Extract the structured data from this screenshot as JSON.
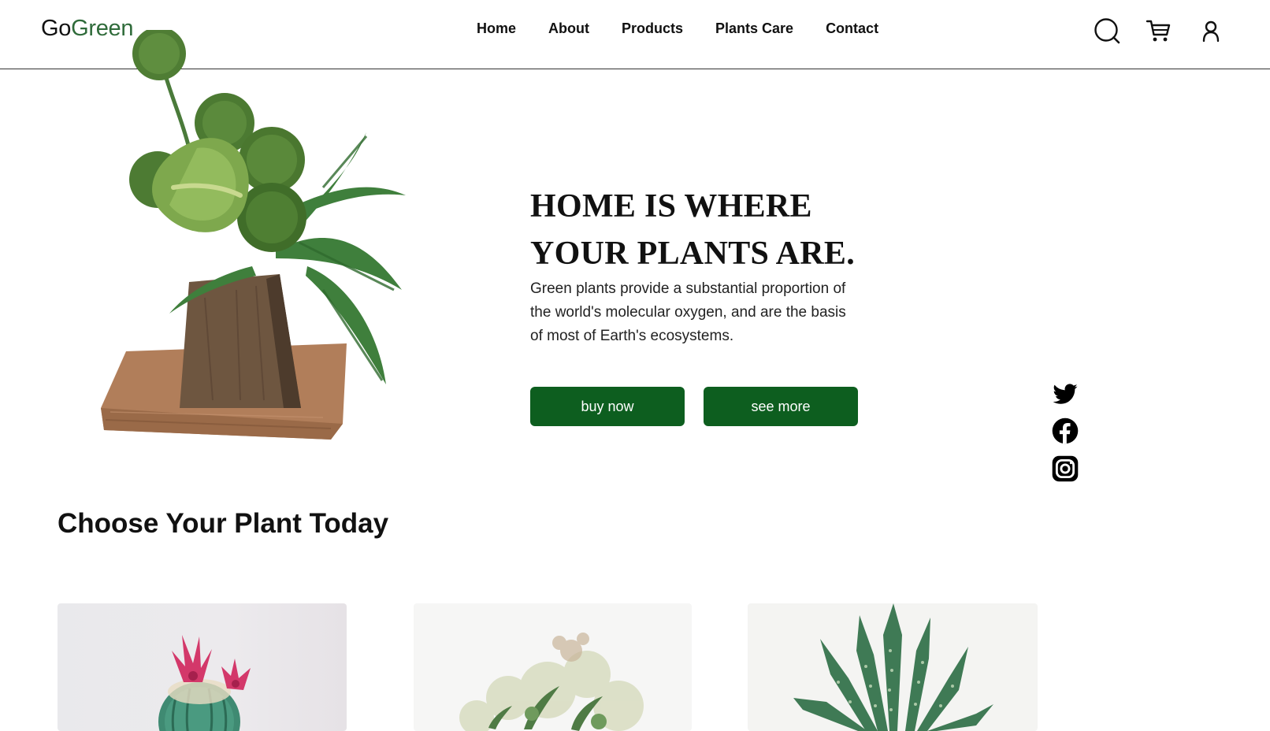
{
  "brand": {
    "go": "Go",
    "green": "Green"
  },
  "nav": {
    "items": [
      {
        "label": "Home"
      },
      {
        "label": "About"
      },
      {
        "label": "Products"
      },
      {
        "label": "Plants Care"
      },
      {
        "label": "Contact"
      }
    ]
  },
  "header_icons": [
    "search-icon",
    "cart-icon",
    "user-icon"
  ],
  "hero": {
    "title_line1": "HOME IS WHERE",
    "title_line2": "YOUR PLANTS ARE.",
    "description": "Green plants provide a substantial proportion of the world's molecular oxygen, and are the basis of most of Earth's ecosystems.",
    "buy_label": "buy now",
    "more_label": "see more"
  },
  "social": [
    "twitter-icon",
    "facebook-icon",
    "instagram-icon"
  ],
  "products": {
    "title": "Choose Your Plant Today",
    "cards": [
      "cactus-image",
      "flower-bouquet-image",
      "aloe-image"
    ]
  },
  "colors": {
    "accent": "#0d5e1f",
    "brand_green": "#2f6b3a",
    "text": "#111111"
  }
}
